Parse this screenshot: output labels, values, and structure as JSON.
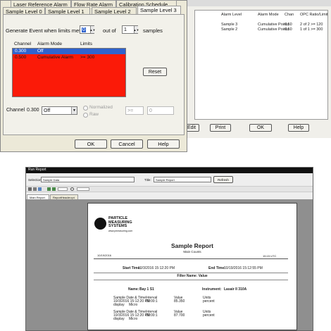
{
  "dialog": {
    "tabs_row1": [
      "Laser Reference Alarm",
      "Flow Rate Alarm",
      "Calibration Schedule"
    ],
    "tabs_row2": [
      "Sample Level 0",
      "Sample Level 1",
      "Sample Level 2",
      "Sample Level 3"
    ],
    "generate_label": "Generate Event when limits met",
    "count_value": "0",
    "out_of_label": "out of",
    "samples_value": "1",
    "samples_label": "samples",
    "table_headers": [
      "Channel",
      "Alarm Mode",
      "Limits"
    ],
    "rows": [
      {
        "channel": "0.300",
        "mode": "Off",
        "limit": ""
      },
      {
        "channel": "0.500",
        "mode": "Cumulative Alarm",
        "limit": ">= 300"
      }
    ],
    "reset_label": "Reset",
    "channel_label": "Channel",
    "channel_value": "0.300",
    "mode_value": "Off",
    "normalized_label": "Normalized",
    "raw_label": "Raw",
    "op_value": ">=",
    "limit_value": "0",
    "ok_label": "OK",
    "cancel_label": "Cancel",
    "help_label": "Help"
  },
  "list_window": {
    "headers": [
      "Alarm Level",
      "Alarm Mode",
      "Chan",
      "OPC Ratio/Limit"
    ],
    "rows": [
      {
        "level": "Sample 3",
        "mode": "Cumulative Points",
        "chan": "0.50",
        "ratio": "2 of 2 >= 120"
      },
      {
        "level": "Sample 2",
        "mode": "Cumulative Points",
        "chan": "0.50",
        "ratio": "1 of 1 >= 300"
      }
    ],
    "buttons": [
      "Edit",
      "Print",
      "OK",
      "Help"
    ]
  },
  "report_window": {
    "title": "Run Report",
    "selection_label": "Selection:",
    "selection_value": "Sample Data",
    "title_label": "Title:",
    "title_value": "Sample Report",
    "refresh_label": "Refresh",
    "tabs": [
      "Main Report",
      "ReportHeader.rpt"
    ],
    "logo_lines": [
      "PARTICLE",
      "MEASURING",
      "SYSTEMS"
    ],
    "logo_url": "www.pmeasuring.com",
    "report_title": "Sample Report",
    "report_subtitle": "Main Counts",
    "date_left": "10/19/2016",
    "time_right": "15:15 UTC",
    "start_time_label": "Start Time:",
    "start_time_value": "10/3/2016 15:12:20 PM",
    "end_time_label": "End Time:",
    "end_time_value": "10/19/2016 15:12:55 PM",
    "filter_label": "Filter Name: Value",
    "name_label": "Name:",
    "name_value": "Bay 1 S1",
    "instrument_label": "Instrument:",
    "instrument_value": "Lasair II 310A",
    "blocks": [
      {
        "a": "Sample Date & Time",
        "b": "Interval",
        "c": "Value",
        "d": "Units",
        "a2": "10/3/2016  15:12:20 PM",
        "b2": "00:00:1",
        "c2": "85.350",
        "d2": "percent",
        "a3": "display",
        "b3": "Micro"
      },
      {
        "a": "Sample Date & Time",
        "b": "Interval",
        "c": "Value",
        "d": "Units",
        "a2": "10/3/2016  15:12:20 PM",
        "b2": "00:00:1",
        "c2": "87.700",
        "d2": "percent",
        "a3": "display",
        "b3": "Micro"
      }
    ]
  },
  "colors": {
    "alarm_red": "#fb1a08",
    "selection_blue": "#2f63ce",
    "window_bg": "#ece9d8"
  }
}
